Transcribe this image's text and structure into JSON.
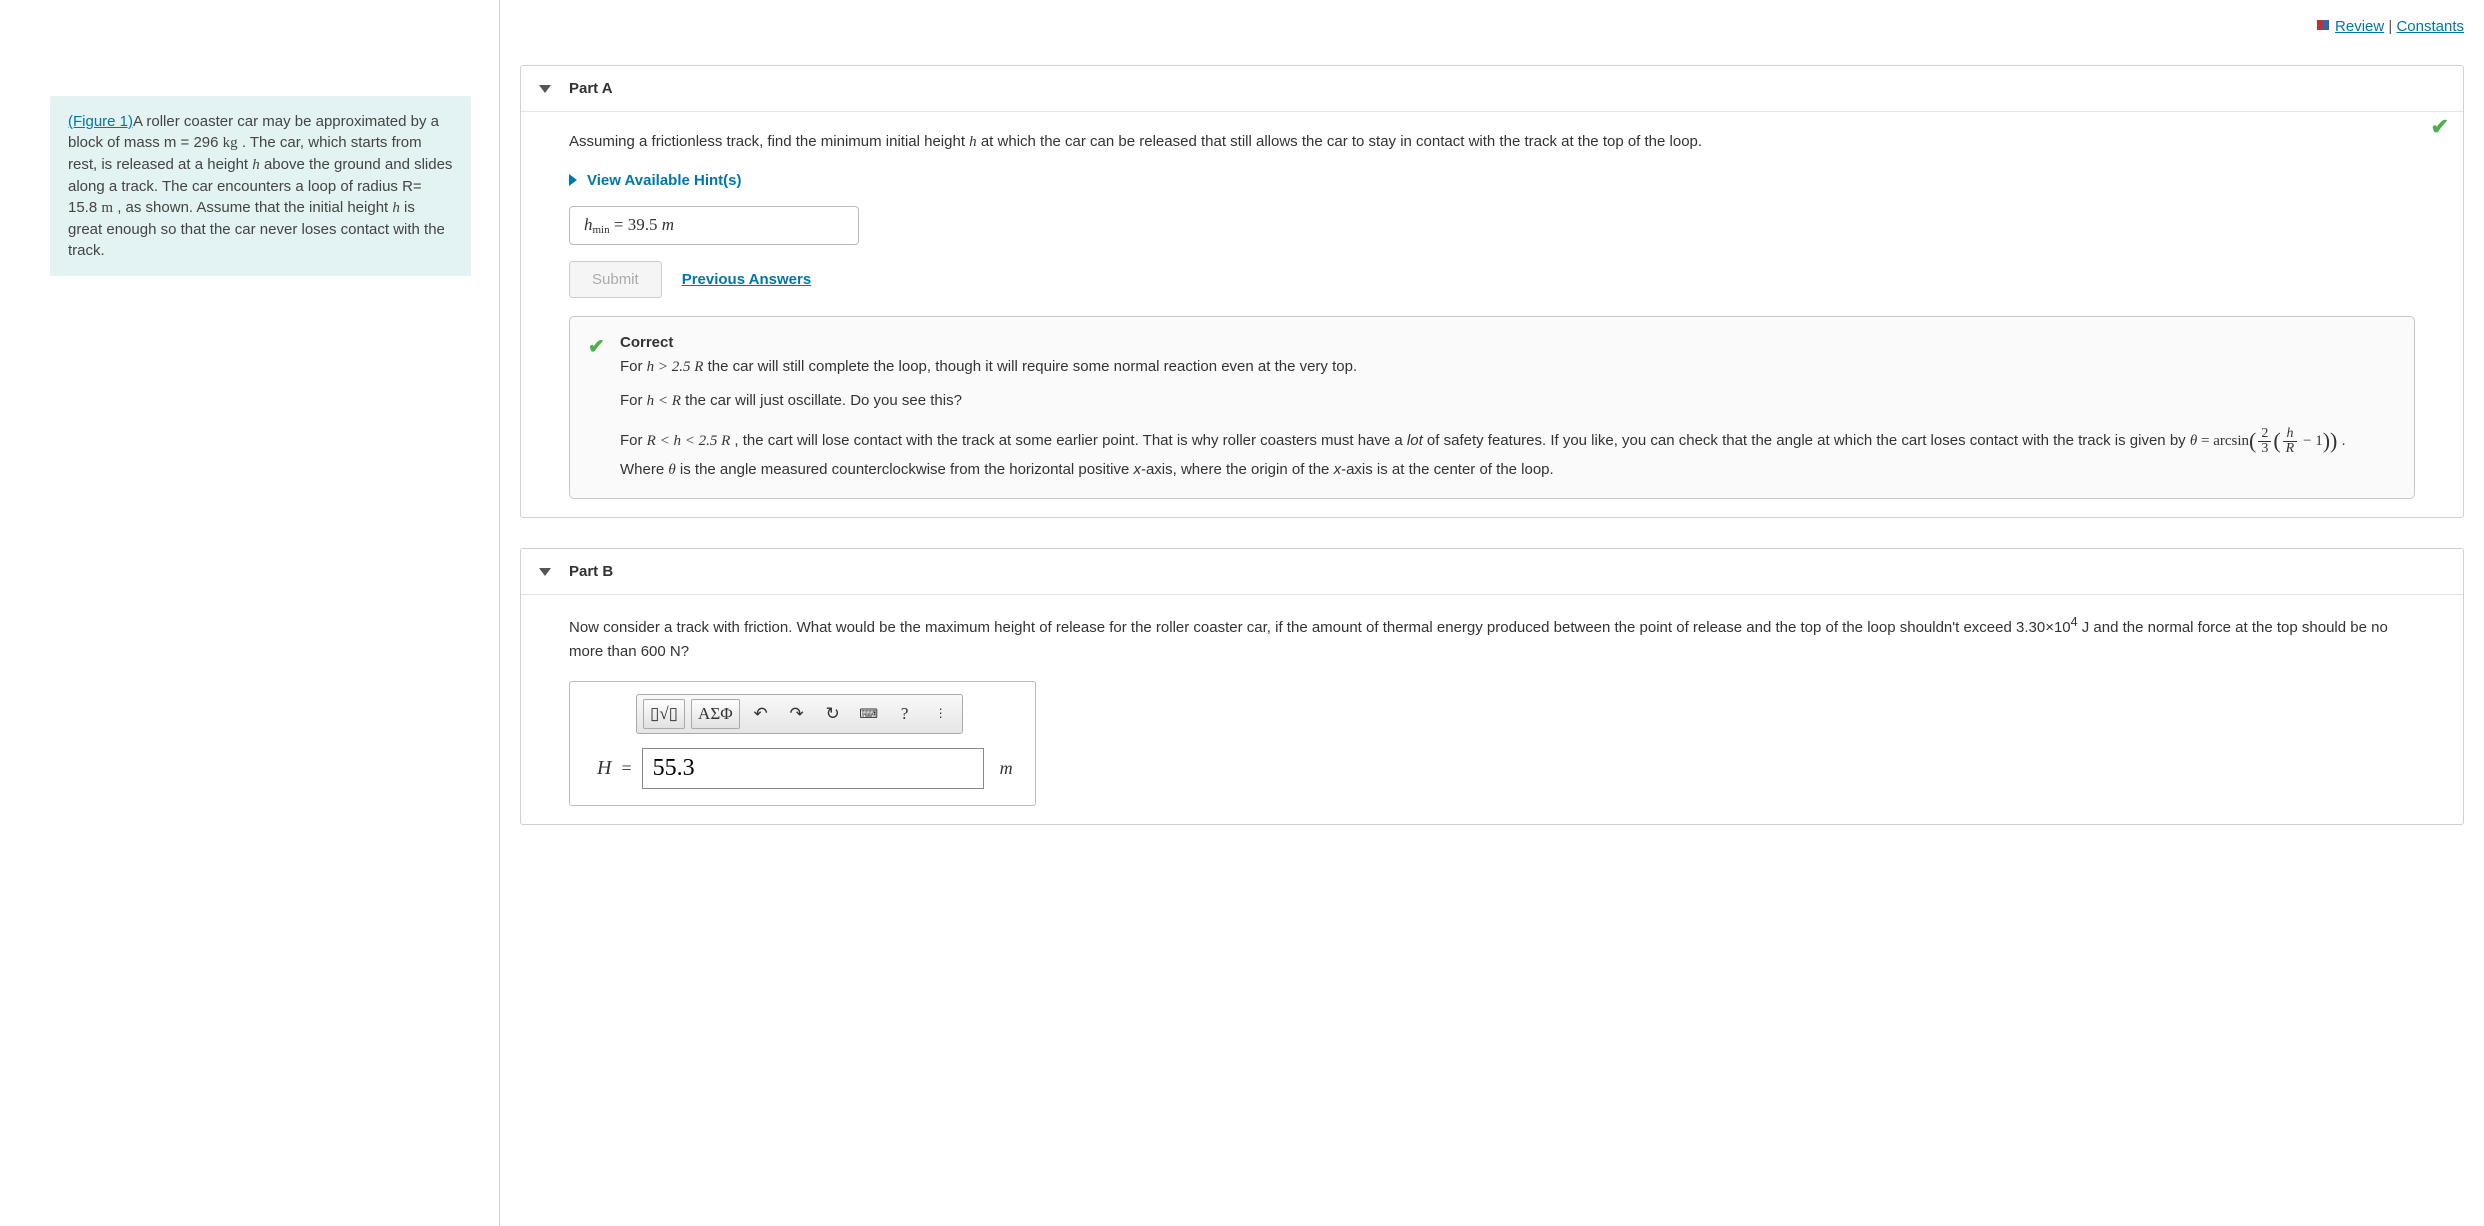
{
  "top_links": {
    "review": "Review",
    "sep": " | ",
    "constants": "Constants"
  },
  "problem": {
    "figure_link": "(Figure 1)",
    "text_1": "A roller coaster car may be approximated by a block of mass m = 296 ",
    "unit_kg": "kg",
    "text_2": " . The car, which starts from rest, is released at a height ",
    "var_h": "h",
    "text_3": " above the ground and slides along a track. The car encounters a loop of radius R= 15.8 ",
    "unit_m": "m",
    "text_4": " , as shown. Assume that the initial height ",
    "text_5": " is great enough so that the car never loses contact with the track."
  },
  "partA": {
    "title": "Part A",
    "prompt_1": "Assuming a frictionless track, find the minimum initial height ",
    "prompt_var": "h",
    "prompt_2": " at which the car can be released that still allows the car to stay in contact with the track at the top of the loop.",
    "hints": "View Available Hint(s)",
    "ans_label_base": "h",
    "ans_label_sub": "min",
    "eq": " = ",
    "ans_value": "39.5",
    "ans_unit": " m",
    "submit": "Submit",
    "prev": "Previous Answers",
    "feedback": {
      "correct": "Correct",
      "line1a": "For ",
      "line1b": "h > 2.5 R",
      "line1c": "  the car will still complete the loop, though it will require some normal reaction even at the very top.",
      "line2a": "For ",
      "line2b": "h < R",
      "line2c": " the car will just oscillate. Do you see this?",
      "line3a": "For ",
      "line3b": "R < h < 2.5 R",
      "line3c": " , the cart will lose contact with the track at some earlier point. That is why roller coasters must have a ",
      "line3d": "lot",
      "line3e": " of safety features. If you like, you can check that the angle at which the cart loses contact with the track is given by ",
      "theta": "θ",
      "eqs": " = ",
      "arcsin": "arcsin",
      "frac1n": "2",
      "frac1d": "3",
      "frac2n": "h",
      "frac2d": "R",
      "minus1": " − 1",
      "line3f": " . Where ",
      "line3g": " is the angle measured counterclockwise from the horizontal positive ",
      "xaxis": "x",
      "line3h": "-axis, where the origin of the ",
      "line3i": "-axis is at the center of the loop."
    }
  },
  "partB": {
    "title": "Part B",
    "prompt_1": "Now consider a track with friction. What would be the maximum height of release for the roller coaster car, if the amount of thermal energy produced between the point of release and the top of the loop shouldn't exceed 3.30×10",
    "prompt_exp": "4",
    "prompt_2": " J   and the normal force at the top should be no more than 600 N?",
    "toolbar": {
      "templates": "▯√▯",
      "greek": "ΑΣΦ",
      "undo": "↶",
      "redo": "↷",
      "reset": "↻",
      "keyboard": "⌨",
      "help": "?",
      "more": "⋮"
    },
    "eq_label": "H",
    "eq_eq": "=",
    "eq_value": "55.3",
    "eq_unit": "m"
  }
}
